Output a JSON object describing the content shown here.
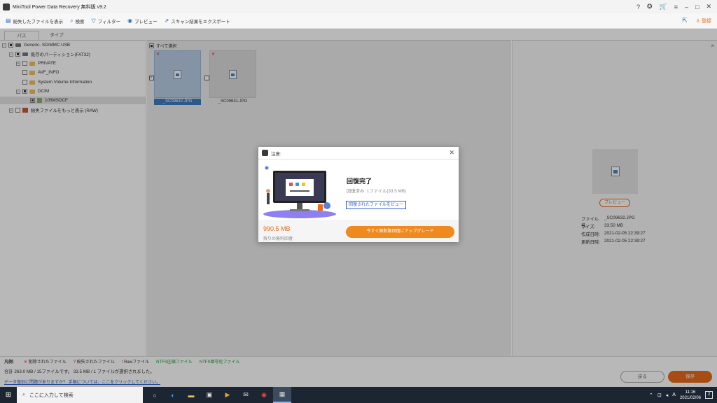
{
  "window": {
    "title": "MiniTool Power Data Recovery 無料版 v9.2"
  },
  "toolbar": {
    "items": [
      {
        "label": "紛失したファイルを表示",
        "icon": "lost-files-icon"
      },
      {
        "label": "検索",
        "icon": "search-icon"
      },
      {
        "label": "フィルター",
        "icon": "filter-icon"
      },
      {
        "label": "プレビュー",
        "icon": "preview-icon"
      },
      {
        "label": "スキャン結果をエクスポート",
        "icon": "export-icon"
      }
    ],
    "login_label": "登録"
  },
  "tabs": [
    {
      "label": "パス"
    },
    {
      "label": "タイプ"
    }
  ],
  "tree": [
    {
      "label": "Generic- SD/MMC USB"
    },
    {
      "label": "既存のパーティション(FAT32)"
    },
    {
      "label": "PRIVATE"
    },
    {
      "label": "AVF_INFO"
    },
    {
      "label": "System Volume Information"
    },
    {
      "label": "DCIM"
    },
    {
      "label": "105MSDCF"
    },
    {
      "label": "紛失ファイルをもっと表示 (RAW)"
    }
  ],
  "main": {
    "select_all_label": "すべて選択",
    "files": [
      {
        "name": "_SC09632.JPG",
        "selected": true
      },
      {
        "name": "_SC09631.JPG",
        "selected": false
      }
    ]
  },
  "right_panel": {
    "preview_label": "プレビュー",
    "info": [
      {
        "key": "ファイル名:",
        "value": "_SC09632.JPG"
      },
      {
        "key": "サイズ:",
        "value": "33.50 MB"
      },
      {
        "key": "作成日時:",
        "value": "2021-02-05 22:39:27"
      },
      {
        "key": "更新日時:",
        "value": "2021-02-05 22:39:27"
      }
    ]
  },
  "legend": {
    "title": "凡例:",
    "deleted": "削除されたファイル",
    "lost": "紛失されたファイル",
    "raw": "Rawファイル",
    "ntfs_compressed": "NTFS圧縮ファイル",
    "ntfs_encrypted": "NTFS暗号化ファイル"
  },
  "status": {
    "summary": "合計 263.0 MB / 15ファイルです。 33.5 MB / 1 ファイルが選択されました。",
    "help_link": "データ復旧に問題がありますか？ 手順については、ここをクリックしてください。"
  },
  "buttons": {
    "back": "戻る",
    "save": "保存"
  },
  "dialog": {
    "title": "注意:",
    "heading": "回復完了",
    "subtitle": "回復済み: 1ファイル(33.5 MB)",
    "view_link": "回復されたファイルをビュー",
    "remaining_size": "990.5 MB",
    "remaining_label": "残りの無料回復",
    "upgrade_button": "今すぐ無制限回復にアップグレード"
  },
  "taskbar": {
    "search_placeholder": "ここに入力して検索",
    "time": "11:16",
    "date": "2021/02/06",
    "ime": "A",
    "notifications": "2"
  },
  "colors": {
    "accent": "#e86a1a",
    "link": "#2d62c4",
    "selection": "#3f7cc0"
  }
}
